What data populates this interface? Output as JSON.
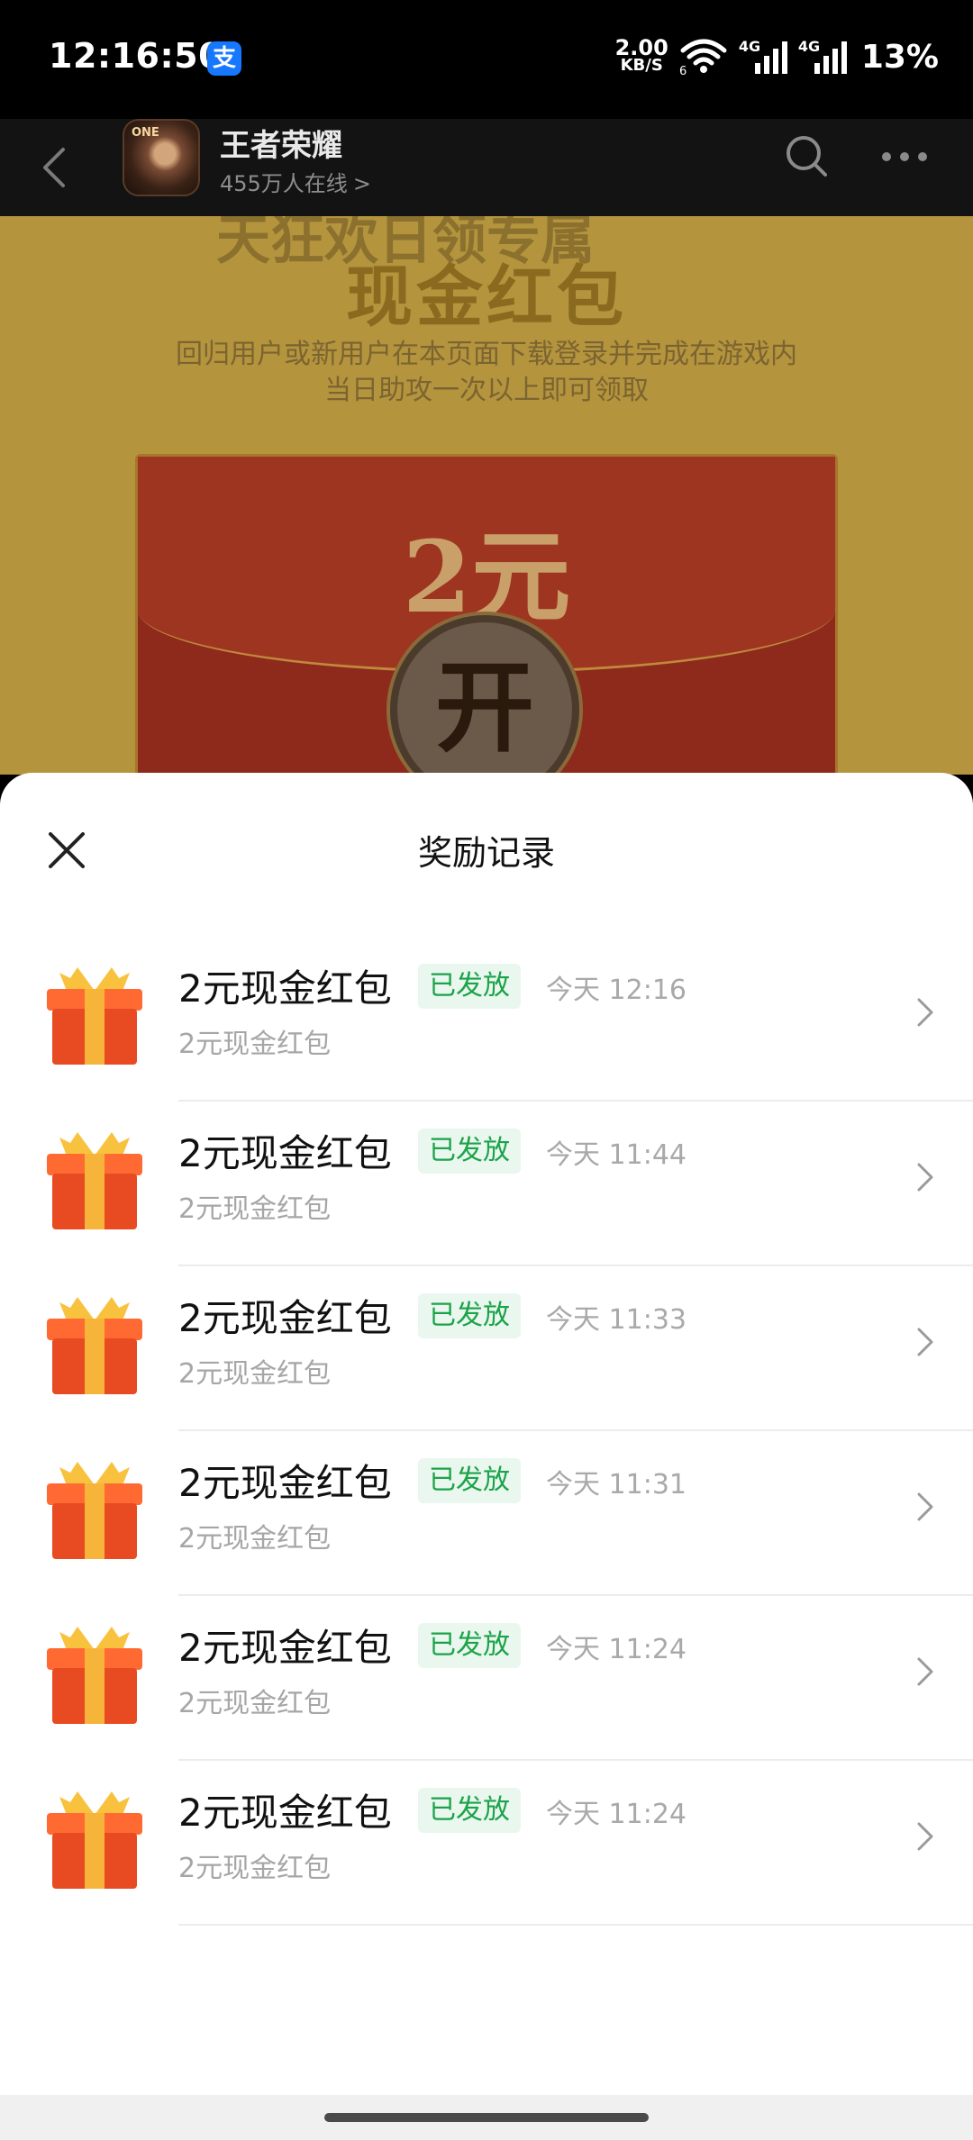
{
  "status_bar": {
    "time": "12:16:50",
    "alipay_glyph": "支",
    "net_speed_value": "2.00",
    "net_speed_unit": "KB/S",
    "wifi_sub": "6",
    "sim1_type": "4G",
    "sim2_type": "4G",
    "battery": "13%"
  },
  "header": {
    "title": "王者荣耀",
    "subtitle": "455万人在线",
    "subtitle_arrow": ">"
  },
  "background_page": {
    "partial_top_text": "天狂欢日领专属",
    "title": "现金红包",
    "desc_line1": "回归用户或新用户在本页面下载登录并完成在游戏内",
    "desc_line2": "当日助攻一次以上即可领取",
    "envelope_amount": "2元",
    "open_button": "开"
  },
  "sheet": {
    "title": "奖励记录",
    "records": [
      {
        "title": "2元现金红包",
        "status": "已发放",
        "time": "今天 12:16",
        "subtitle": "2元现金红包"
      },
      {
        "title": "2元现金红包",
        "status": "已发放",
        "time": "今天 11:44",
        "subtitle": "2元现金红包"
      },
      {
        "title": "2元现金红包",
        "status": "已发放",
        "time": "今天 11:33",
        "subtitle": "2元现金红包"
      },
      {
        "title": "2元现金红包",
        "status": "已发放",
        "time": "今天 11:31",
        "subtitle": "2元现金红包"
      },
      {
        "title": "2元现金红包",
        "status": "已发放",
        "time": "今天 11:24",
        "subtitle": "2元现金红包"
      },
      {
        "title": "2元现金红包",
        "status": "已发放",
        "time": "今天 11:24",
        "subtitle": "2元现金红包"
      }
    ]
  },
  "icons": {
    "back": "chevron-left-icon",
    "search": "search-icon",
    "more": "more-icon",
    "close": "close-icon",
    "gift": "gift-icon",
    "chevron": "chevron-right-icon"
  },
  "colors": {
    "status_badge_text": "#1ca34a",
    "status_badge_bg": "#e9f7ee",
    "gift_body": "#f0562a",
    "gift_ribbon": "#f7b43a"
  }
}
